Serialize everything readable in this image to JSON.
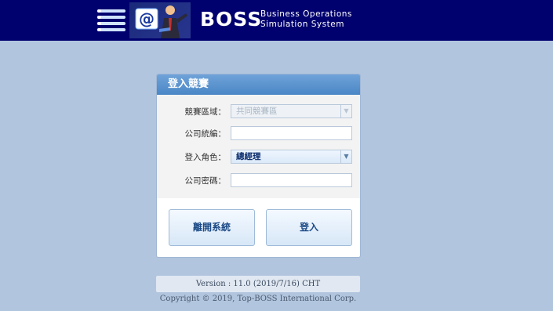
{
  "header": {
    "brand": "BOSS",
    "subtitle_line1": "Business Operations",
    "subtitle_line2": "Simulation System",
    "bg_color": "#00006e",
    "icons": [
      "menu-icon",
      "email-presenter-icon"
    ]
  },
  "login": {
    "title": "登入競賽",
    "competition_area": {
      "label": "競賽區域：",
      "value": "共同競賽區",
      "disabled": true
    },
    "company_id": {
      "label": "公司統編：",
      "value": ""
    },
    "role": {
      "label": "登入角色：",
      "value": "總經理"
    },
    "password": {
      "label": "公司密碼：",
      "value": ""
    },
    "exit_button": "離開系統",
    "login_button": "登入"
  },
  "footer": {
    "version": "Version : 11.0 (2019/7/16) CHT",
    "copyright": "Copyright © 2019, Top-BOSS International Corp."
  },
  "colors": {
    "page_bg": "#b1c5de",
    "panel_title": "#4a86c6",
    "button_text": "#1c4a86"
  }
}
